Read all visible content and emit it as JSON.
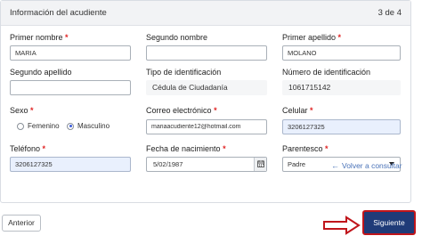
{
  "header": {
    "title": "Información del acudiente",
    "step": "3 de 4"
  },
  "fields": {
    "primer_nombre": {
      "label": "Primer nombre",
      "required": "*",
      "value": "MARIA"
    },
    "segundo_nombre": {
      "label": "Segundo nombre",
      "value": ""
    },
    "primer_apellido": {
      "label": "Primer apellido",
      "required": "*",
      "value": "MOLANO"
    },
    "segundo_apellido": {
      "label": "Segundo apellido",
      "value": ""
    },
    "tipo_identificacion": {
      "label": "Tipo de identificación",
      "value": "Cédula de Ciudadanía"
    },
    "numero_identificacion": {
      "label": "Número de identificación",
      "value": "1061715142"
    },
    "sexo": {
      "label": "Sexo",
      "required": "*",
      "options": [
        "Femenino",
        "Masculino"
      ],
      "selected": "Masculino"
    },
    "correo": {
      "label": "Correo electrónico",
      "required": "*",
      "value": "mariaacudiente12@hotmail.com"
    },
    "celular": {
      "label": "Celular",
      "required": "*",
      "value": "3206127325"
    },
    "telefono": {
      "label": "Teléfono",
      "required": "*",
      "value": "3206127325"
    },
    "fecha_nacimiento": {
      "label": "Fecha de nacimiento",
      "required": "*",
      "value": "5/02/1987"
    },
    "parentesco": {
      "label": "Parentesco",
      "required": "*",
      "value": "Padre"
    }
  },
  "links": {
    "back_to_search": "Volver a consultar"
  },
  "buttons": {
    "previous": "Anterior",
    "next": "Siguiente"
  },
  "colors": {
    "primary": "#1f3b78",
    "highlight": "#c0151b",
    "required": "#e02424",
    "link": "#4a73b8",
    "filled_bg": "#e9f0fd"
  }
}
